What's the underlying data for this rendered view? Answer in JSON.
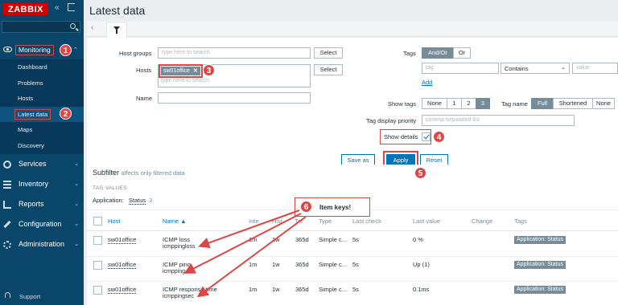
{
  "sidebar": {
    "logo": "ZABBIX",
    "collapse_icon": "«",
    "nav_top": {
      "label": "Monitoring",
      "chevron": "⌃"
    },
    "submenu": [
      {
        "label": "Dashboard"
      },
      {
        "label": "Problems"
      },
      {
        "label": "Hosts"
      },
      {
        "label": "Latest data",
        "selected": true
      },
      {
        "label": "Maps"
      },
      {
        "label": "Discovery"
      }
    ],
    "nav": [
      {
        "label": "Services",
        "icon": "services-icon"
      },
      {
        "label": "Inventory",
        "icon": "inventory-icon"
      },
      {
        "label": "Reports",
        "icon": "reports-icon"
      },
      {
        "label": "Configuration",
        "icon": "configuration-icon"
      },
      {
        "label": "Administration",
        "icon": "administration-icon"
      }
    ],
    "support": "Support"
  },
  "page": {
    "title": "Latest data"
  },
  "filter": {
    "host_groups_label": "Host groups",
    "host_groups_placeholder": "type here to search",
    "select_label": "Select",
    "hosts_label": "Hosts",
    "host_chip": "sw01office",
    "chip_remove": "✕",
    "hosts_placeholder": "type here to search",
    "name_label": "Name",
    "tags_label": "Tags",
    "and_or": "And/Or",
    "or": "Or",
    "tag_placeholder": "tag",
    "operator": "Contains",
    "value_placeholder": "value",
    "add": "Add",
    "show_tags_label": "Show tags",
    "show_tags_options": [
      "None",
      "1",
      "2",
      "3"
    ],
    "tag_name_label": "Tag name",
    "tag_name_options": [
      "Full",
      "Shortened",
      "None"
    ],
    "tag_priority_label": "Tag display priority",
    "tag_priority_placeholder": "comma-separated list",
    "show_details_label": "Show details",
    "save_as": "Save as",
    "apply": "Apply",
    "reset": "Reset"
  },
  "subfilter": {
    "title": "Subfilter",
    "subtitle": "affects only filtered data",
    "tag_values": "TAG VALUES",
    "application_label": "Application:",
    "application_value": "Status",
    "application_count": "3"
  },
  "table": {
    "headers": {
      "host": "Host",
      "name": "Name ▲",
      "interval": "Inte",
      "history": "Hist",
      "trends": "Tre",
      "type": "Type",
      "last_check": "Last check",
      "last_value": "Last value",
      "change": "Change",
      "tags": "Tags"
    },
    "rows": [
      {
        "host": "sw01office",
        "name": "ICMP loss",
        "key": "icmppingloss",
        "interval": "1m",
        "history": "1w",
        "trends": "365d",
        "type": "Simple c...",
        "last_check": "5s",
        "last_value": "0 %",
        "change": "",
        "tag": "Application: Status"
      },
      {
        "host": "sw01office",
        "name": "ICMP ping",
        "key": "icmpping",
        "interval": "1m",
        "history": "1w",
        "trends": "365d",
        "type": "Simple c...",
        "last_check": "5s",
        "last_value": "Up (1)",
        "change": "",
        "tag": "Application: Status"
      },
      {
        "host": "sw01office",
        "name": "ICMP response time",
        "key": "icmppingsec",
        "interval": "1m",
        "history": "1w",
        "trends": "365d",
        "type": "Simple c...",
        "last_check": "5s",
        "last_value": "0.1ms",
        "change": "",
        "tag": "Application: Status"
      }
    ]
  },
  "annotations": {
    "badges": [
      "1",
      "2",
      "3",
      "4",
      "5",
      "6"
    ],
    "callout": "Item keys!",
    "color": "#e04545"
  }
}
